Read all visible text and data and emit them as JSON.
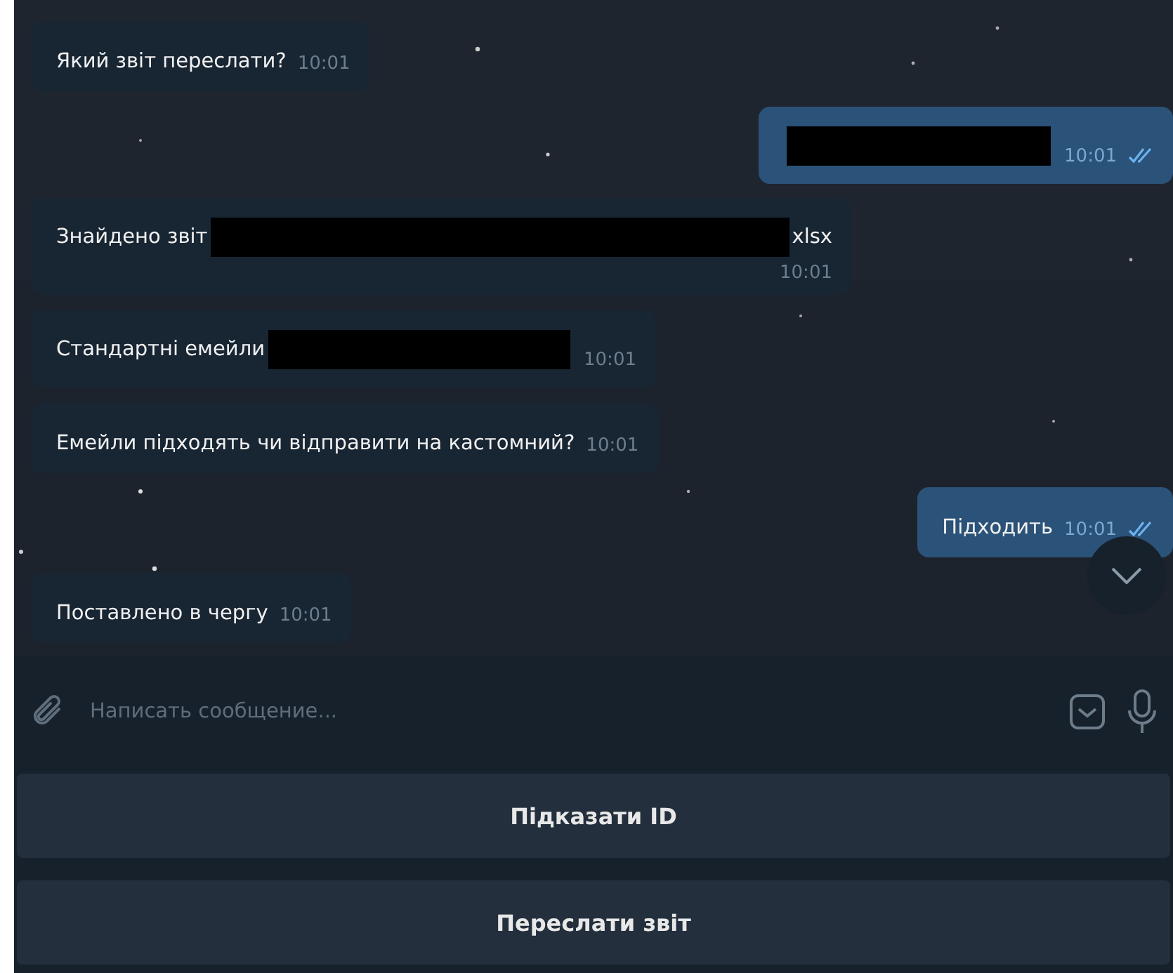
{
  "messages": [
    {
      "kind": "incoming",
      "segments": [
        {
          "kind": "text",
          "text": "Який звіт переслати?"
        }
      ],
      "time": "10:01",
      "read": false
    },
    {
      "kind": "outgoing",
      "segments": [
        {
          "kind": "redacted"
        }
      ],
      "time": "10:01",
      "read": true
    },
    {
      "kind": "incoming",
      "segments": [
        {
          "kind": "text",
          "text": "Знайдено звіт"
        },
        {
          "kind": "redacted"
        },
        {
          "kind": "text",
          "text": "xlsx"
        }
      ],
      "time": "10:01",
      "read": false,
      "time_below": true
    },
    {
      "kind": "incoming",
      "segments": [
        {
          "kind": "text",
          "text": "Стандартні емейли"
        },
        {
          "kind": "redacted"
        }
      ],
      "time": "10:01",
      "read": false
    },
    {
      "kind": "incoming",
      "segments": [
        {
          "kind": "text",
          "text": "Емейли підходять чи відправити на кастомний?"
        }
      ],
      "time": "10:01",
      "read": false
    },
    {
      "kind": "outgoing",
      "segments": [
        {
          "kind": "text",
          "text": "Підходить"
        }
      ],
      "time": "10:01",
      "read": true
    },
    {
      "kind": "incoming",
      "segments": [
        {
          "kind": "text",
          "text": "Поставлено в чергу"
        }
      ],
      "time": "10:01",
      "read": false
    }
  ],
  "composer": {
    "placeholder": "Написать сообщение..."
  },
  "bot_buttons": [
    "Підказати ID",
    "Переслати звіт"
  ]
}
